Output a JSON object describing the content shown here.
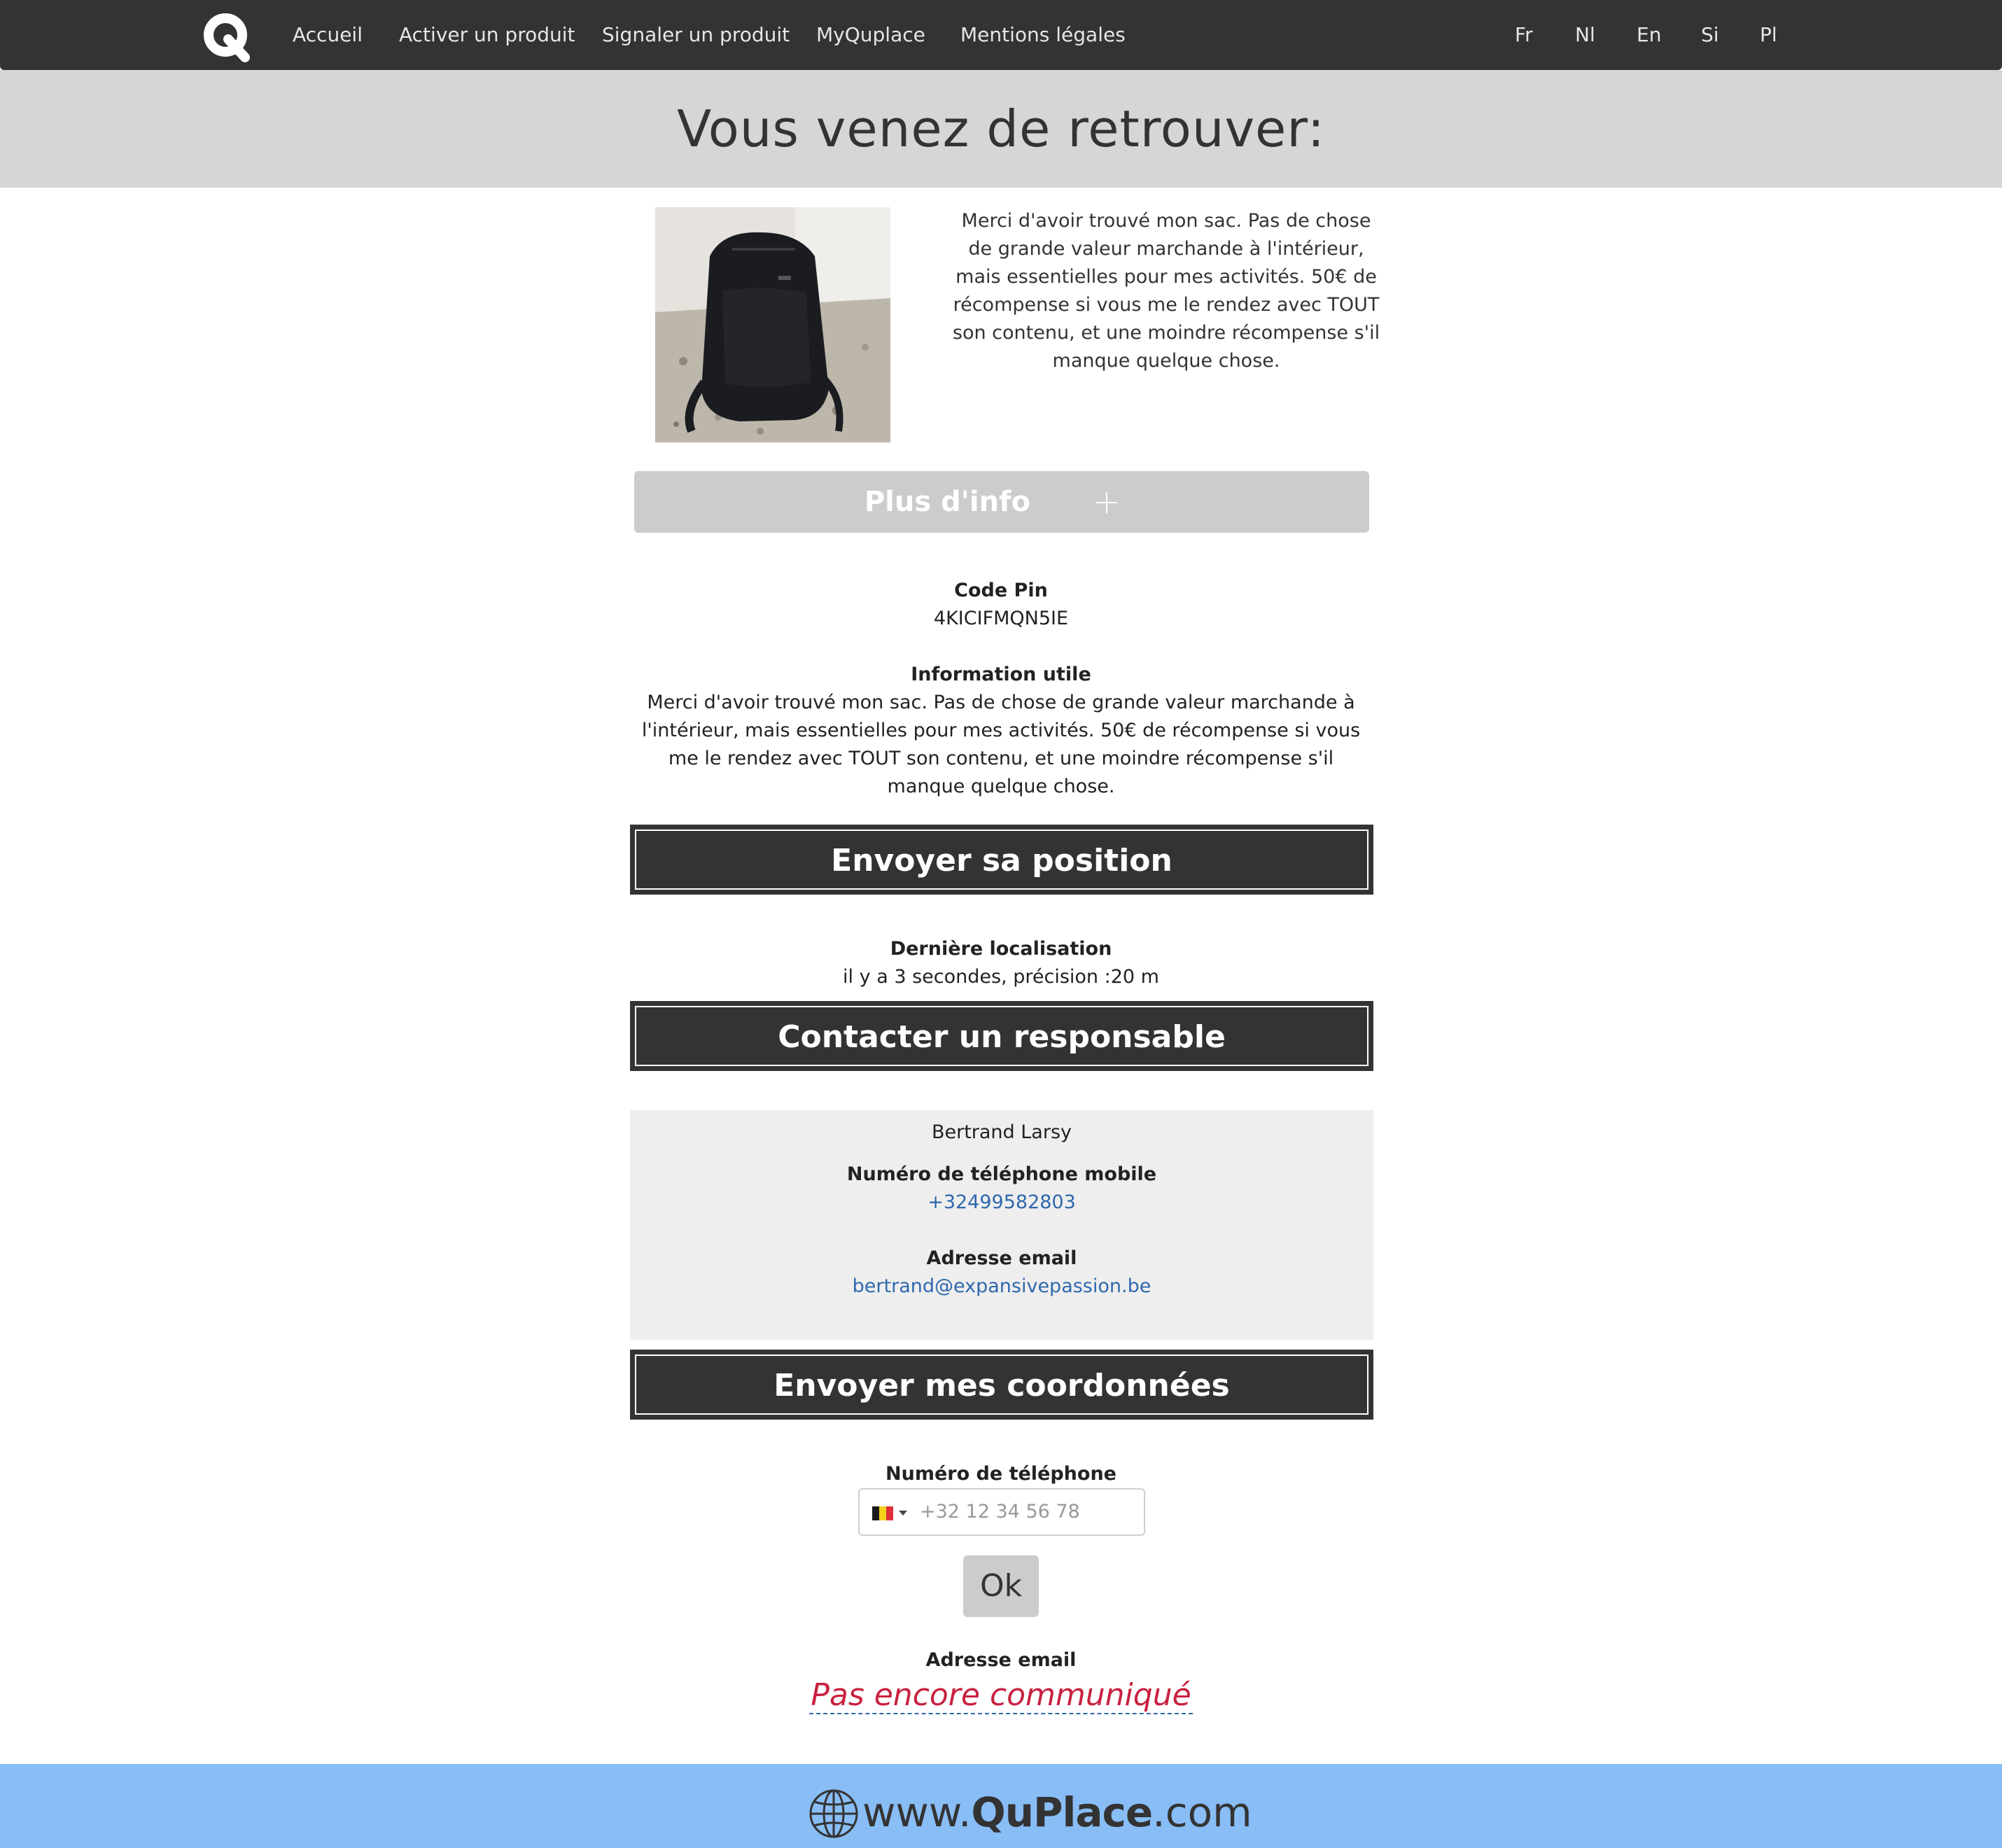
{
  "nav": {
    "links": [
      "Accueil",
      "Activer un produit",
      "Signaler un produit",
      "MyQuplace",
      "Mentions légales"
    ],
    "languages": [
      "Fr",
      "Nl",
      "En",
      "Si",
      "Pl"
    ]
  },
  "page_title": "Vous venez de retrouver:",
  "product": {
    "short_text": "Merci d'avoir trouvé mon sac. Pas de chose de grande valeur marchande à l'intérieur, mais essentielles pour mes activités. 50€ de récompense si vous me le rendez avec TOUT son contenu, et une moindre récompense s'il manque quelque chose.",
    "more_info_label": "Plus d'info"
  },
  "pin": {
    "label": "Code Pin",
    "value": "4KICIFMQN5IE"
  },
  "useful_info": {
    "label": "Information utile",
    "text": "Merci d'avoir trouvé mon sac. Pas de chose de grande valeur marchande à l'intérieur, mais essentielles pour mes activités. 50€ de récompense si vous me le rendez avec TOUT son contenu, et une moindre récompense s'il manque quelque chose."
  },
  "send_position_label": "Envoyer sa position",
  "last_location": {
    "label": "Dernière localisation",
    "value": "il y a 3 secondes, précision :20 m"
  },
  "contact_label": "Contacter un responsable",
  "contact": {
    "name": "Bertrand Larsy",
    "phone_label": "Numéro de téléphone mobile",
    "phone": "+32499582803",
    "email_label": "Adresse email",
    "email": "bertrand@expansivepassion.be"
  },
  "send_details_label": "Envoyer mes coordonnées",
  "my_details": {
    "phone_label": "Numéro de téléphone",
    "phone_placeholder": "+32 12 34 56 78",
    "ok_label": "Ok",
    "email_label": "Adresse email",
    "email_status": "Pas encore communiqué"
  },
  "footer": {
    "prefix": "www.",
    "brand": "QuPlace",
    "suffix": ".com"
  },
  "colors": {
    "navbar": "#333333",
    "title_band": "#d6d6d6",
    "link": "#2f68ad",
    "alert": "#c8213f",
    "footer": "#88bdf5",
    "flag": [
      "#1a1a1a",
      "#f5d21c",
      "#e0313a"
    ]
  }
}
